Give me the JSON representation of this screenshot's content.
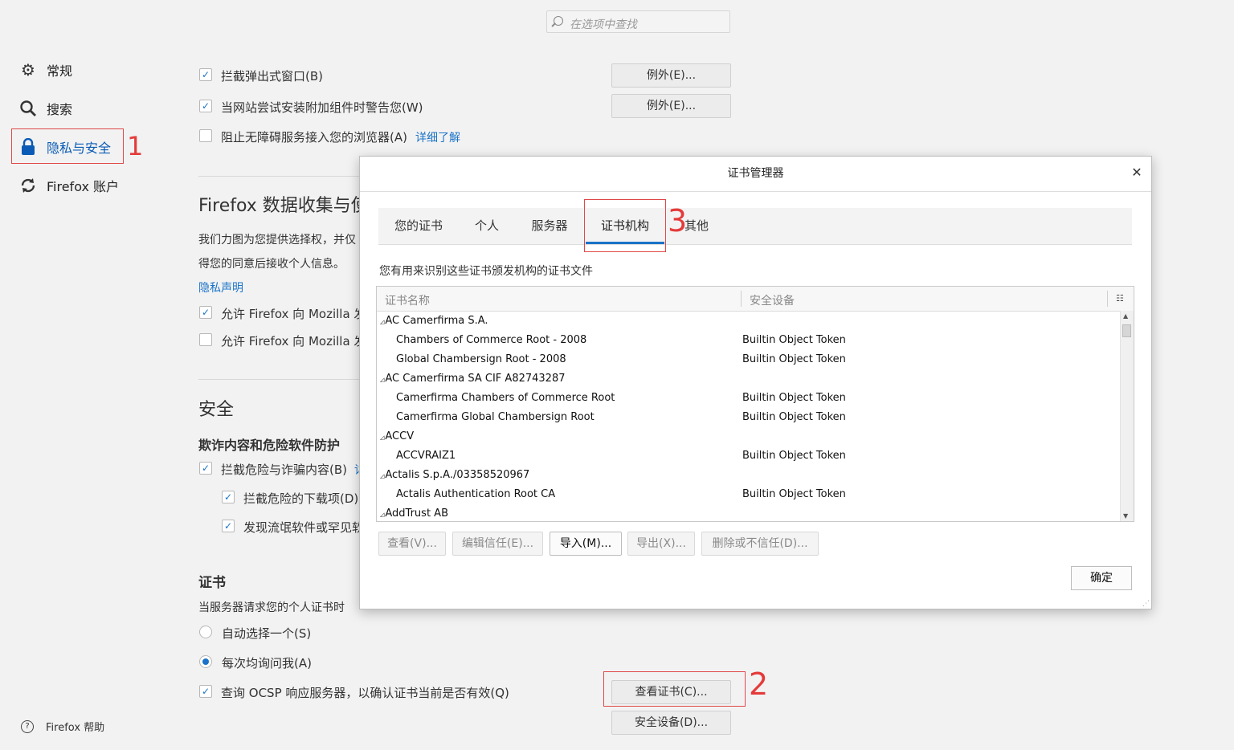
{
  "search": {
    "placeholder": "在选项中查找"
  },
  "sidebar": {
    "items": [
      {
        "label": "常规",
        "icon": "gear-icon"
      },
      {
        "label": "搜索",
        "icon": "search-icon"
      },
      {
        "label": "隐私与安全",
        "icon": "lock-icon"
      },
      {
        "label": "Firefox 账户",
        "icon": "sync-icon"
      }
    ],
    "help": "Firefox 帮助"
  },
  "permissions": {
    "popups": "拦截弹出式窗口(B)",
    "addons": "当网站尝试安装附加组件时警告您(W)",
    "a11y": "阻止无障碍服务接入您的浏览器(A)",
    "a11y_link": "详细了解",
    "exceptions_label": "例外(E)..."
  },
  "data_collection": {
    "heading": "Firefox 数据收集与使",
    "line1": "我们力图为您提供选择权，并仅",
    "line2": "得您的同意后接收个人信息。",
    "privacy_link": "隐私声明",
    "opt1": "允许 Firefox 向 Mozilla 发",
    "opt2": "允许 Firefox 向 Mozilla 发"
  },
  "security": {
    "heading": "安全",
    "subheading": "欺诈内容和危险软件防护",
    "opt1": "拦截危险与诈骗内容(B)",
    "opt1_link": "详",
    "opt2": "拦截危险的下载项(D)",
    "opt3": "发现流氓软件或罕见软"
  },
  "certs": {
    "heading": "证书",
    "desc": "当服务器请求您的个人证书时",
    "radio1": "自动选择一个(S)",
    "radio2": "每次均询问我(A)",
    "ocsp": "查询 OCSP 响应服务器，以确认证书当前是否有效(Q)",
    "view_btn": "查看证书(C)...",
    "devices_btn": "安全设备(D)..."
  },
  "dialog": {
    "title": "证书管理器",
    "tabs": [
      "您的证书",
      "个人",
      "服务器",
      "证书机构",
      "其他"
    ],
    "selected_tab": "证书机构",
    "desc": "您有用来识别这些证书颁发机构的证书文件",
    "columns": [
      "证书名称",
      "安全设备"
    ],
    "rows": [
      {
        "name": "AC Camerfirma S.A.",
        "device": "",
        "group": true
      },
      {
        "name": "Chambers of Commerce Root - 2008",
        "device": "Builtin Object Token",
        "group": false
      },
      {
        "name": "Global Chambersign Root - 2008",
        "device": "Builtin Object Token",
        "group": false
      },
      {
        "name": "AC Camerfirma SA CIF A82743287",
        "device": "",
        "group": true
      },
      {
        "name": "Camerfirma Chambers of Commerce Root",
        "device": "Builtin Object Token",
        "group": false
      },
      {
        "name": "Camerfirma Global Chambersign Root",
        "device": "Builtin Object Token",
        "group": false
      },
      {
        "name": "ACCV",
        "device": "",
        "group": true
      },
      {
        "name": "ACCVRAIZ1",
        "device": "Builtin Object Token",
        "group": false
      },
      {
        "name": "Actalis S.p.A./03358520967",
        "device": "",
        "group": true
      },
      {
        "name": "Actalis Authentication Root CA",
        "device": "Builtin Object Token",
        "group": false
      },
      {
        "name": "AddTrust AB",
        "device": "",
        "group": true
      }
    ],
    "buttons": {
      "view": "查看(V)...",
      "edit": "编辑信任(E)...",
      "import": "导入(M)...",
      "export": "导出(X)...",
      "delete": "删除或不信任(D)..."
    },
    "ok": "确定"
  },
  "annotations": [
    "1",
    "2",
    "3"
  ],
  "colors": {
    "accent": "#1a73c8",
    "annotation": "#e53a3a"
  }
}
